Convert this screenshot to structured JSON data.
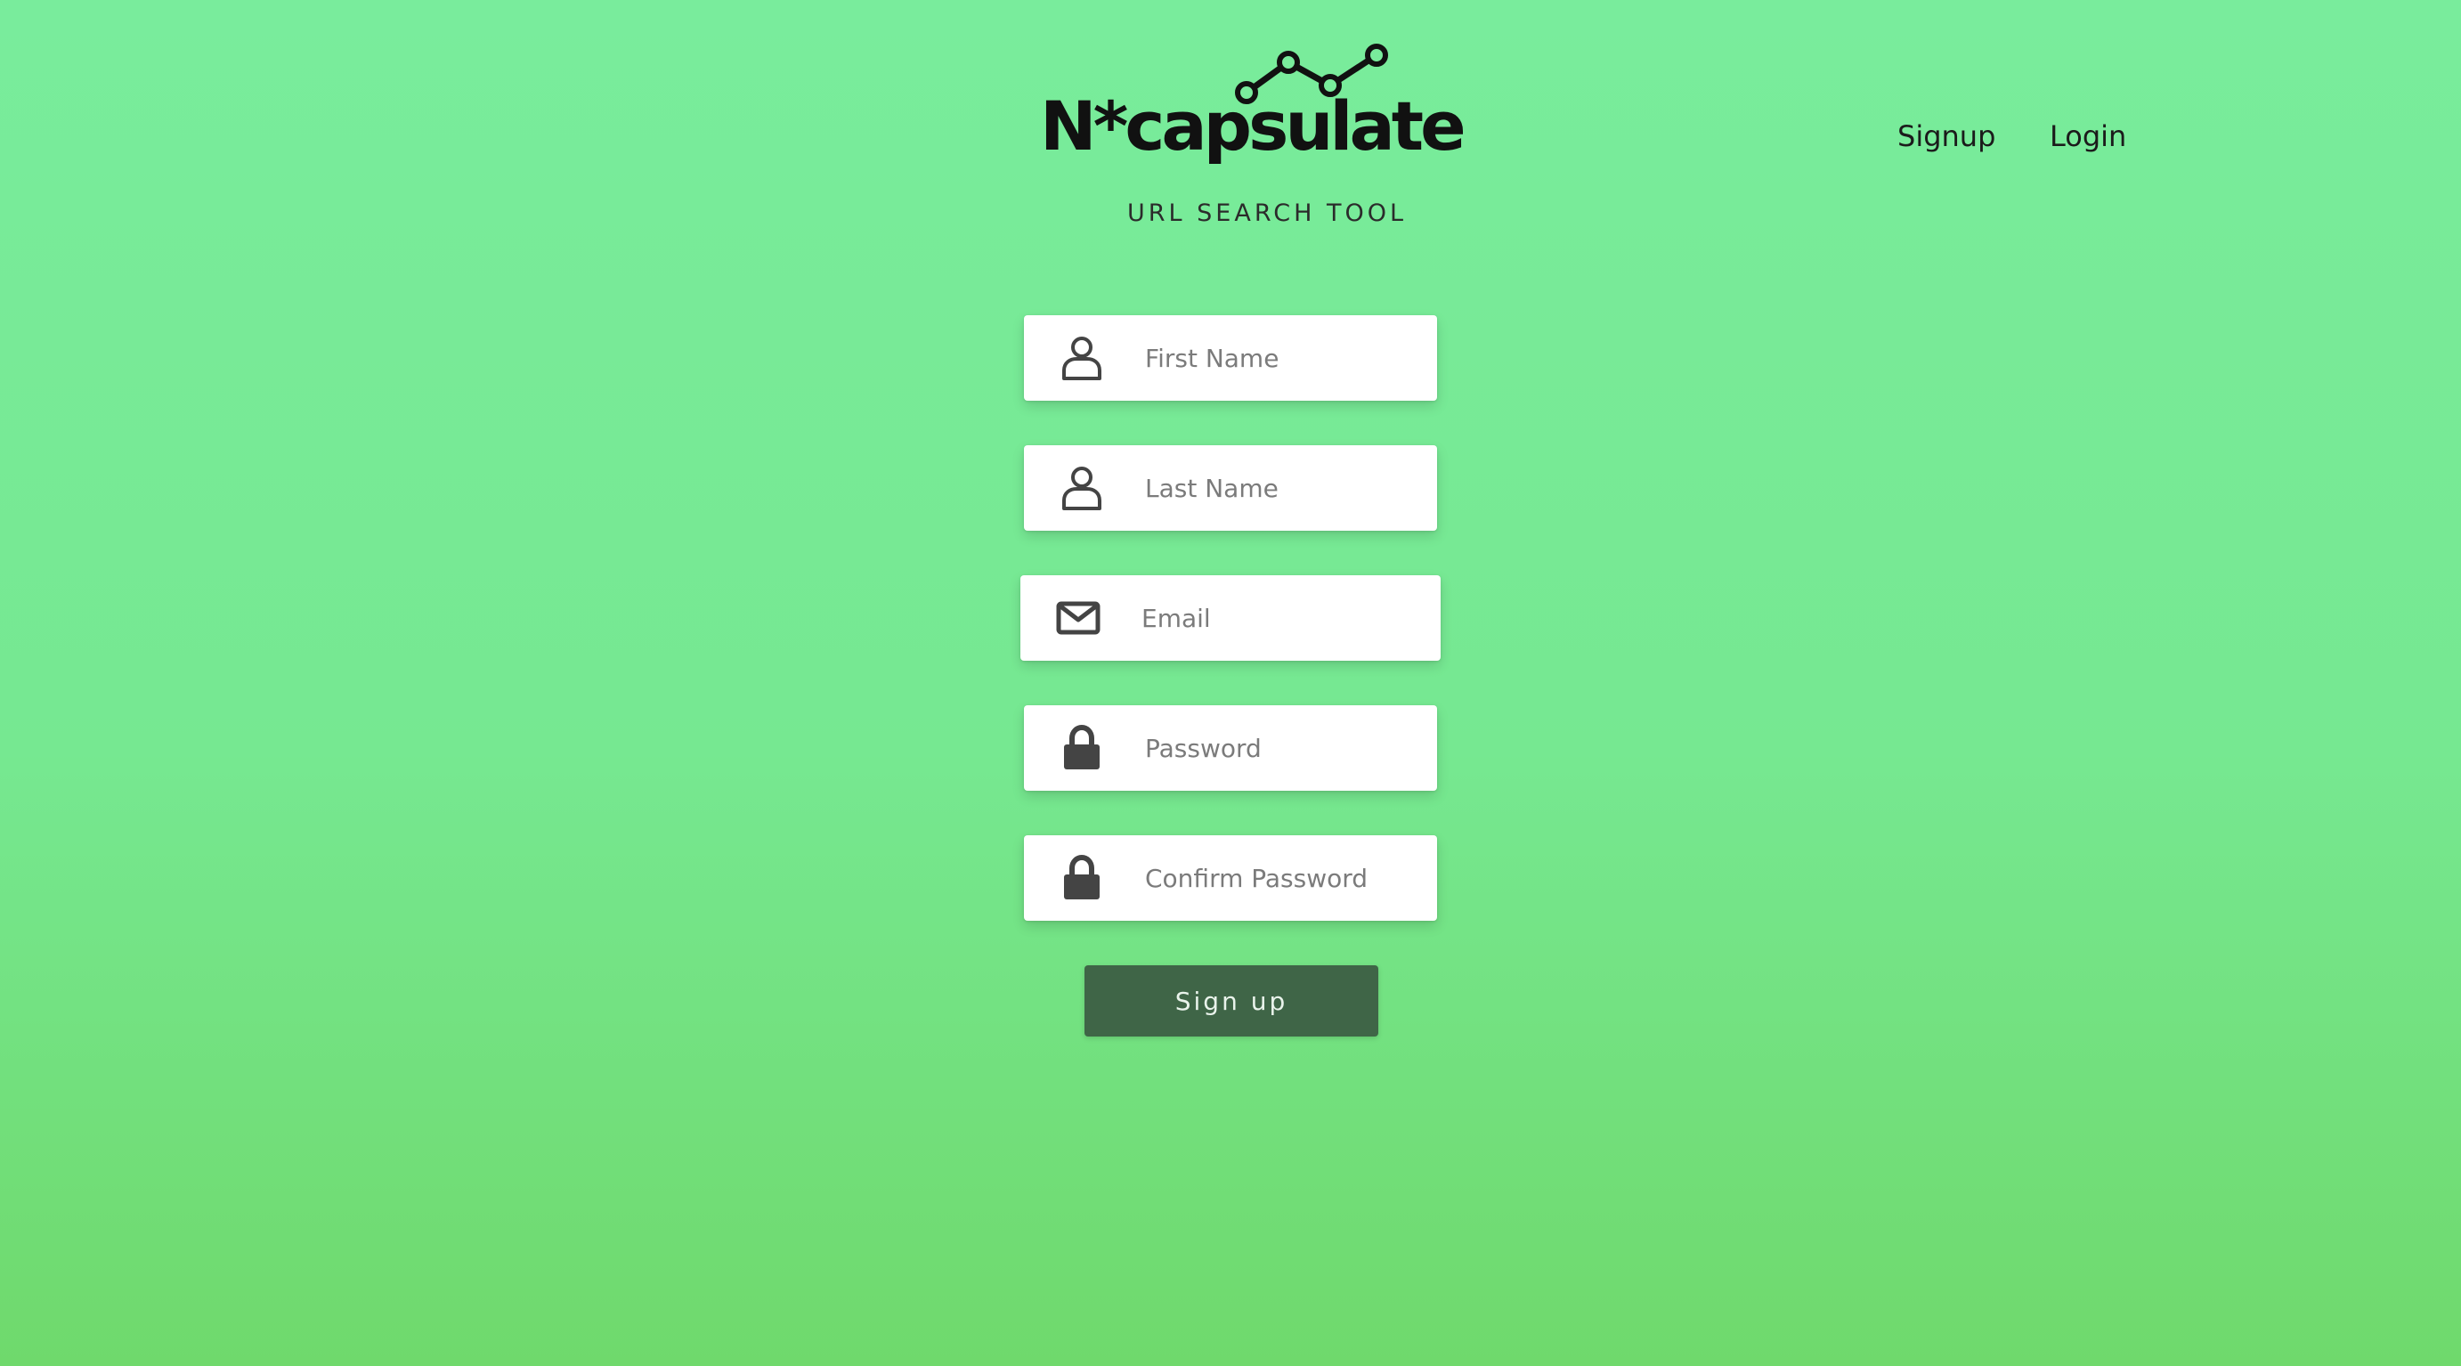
{
  "logo": {
    "wordmark": "N*capsulate",
    "tagline": "URL SEARCH TOOL"
  },
  "nav": {
    "signup_label": "Signup",
    "login_label": "Login"
  },
  "form": {
    "first_name": {
      "placeholder": "First Name",
      "value": "",
      "icon": "user-icon"
    },
    "last_name": {
      "placeholder": "Last Name",
      "value": "",
      "icon": "user-icon"
    },
    "email": {
      "placeholder": "Email",
      "value": "",
      "icon": "envelope-icon"
    },
    "password": {
      "placeholder": "Password",
      "value": "",
      "icon": "lock-icon"
    },
    "confirm_password": {
      "placeholder": "Confirm Password",
      "value": "",
      "icon": "lock-icon"
    },
    "submit_label": "Sign up"
  },
  "colors": {
    "background_top": "#79ec9c",
    "background_bottom": "#6fd96c",
    "button": "#3f6547",
    "icon": "#444444"
  }
}
